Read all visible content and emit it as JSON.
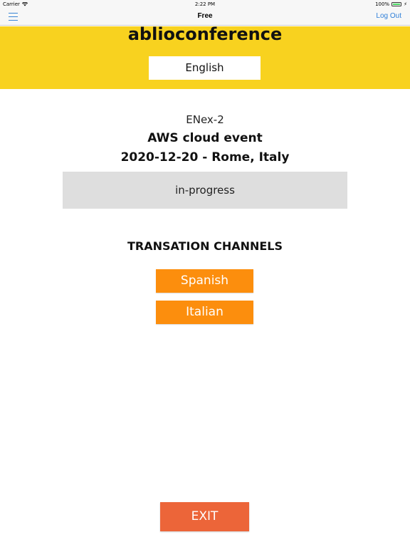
{
  "status_bar": {
    "carrier": "Carrier",
    "time": "2:22 PM",
    "battery": "100%",
    "icons": [
      "wifi-icon",
      "battery-icon",
      "charging-icon"
    ]
  },
  "nav": {
    "title": "Free",
    "logout_label": "Log Out",
    "menu_icon": "hamburger-menu-icon",
    "accent_color": "#2f7fd8"
  },
  "header": {
    "brand": "ablioconference",
    "language": "English",
    "background_color": "#f8d21f"
  },
  "event": {
    "code": "ENex-2",
    "name": "AWS cloud event",
    "date_location": "2020-12-20 - Rome, Italy",
    "status": "in-progress"
  },
  "channels": {
    "heading": "TRANSATION CHANNELS",
    "items": [
      {
        "label": "Spanish"
      },
      {
        "label": "Italian"
      }
    ],
    "button_color": "#fc8e0d"
  },
  "exit": {
    "label": "EXIT",
    "color": "#ec6539"
  }
}
